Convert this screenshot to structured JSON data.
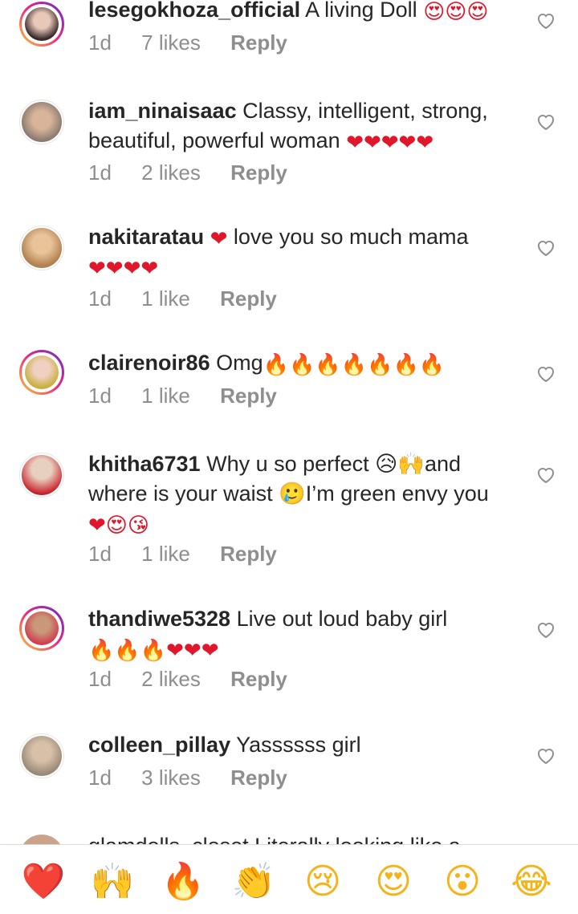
{
  "comments": [
    {
      "username": "lesegokhoza_official",
      "text": "A living Doll",
      "emoji": "😍😍😍",
      "emoji_class": "fire",
      "time": "1d",
      "likes": "7 likes",
      "reply": "Reply"
    },
    {
      "username": "iam_ninaisaac",
      "text": "Classy, intelligent, strong, beautiful, powerful woman",
      "emoji": "❤❤❤❤❤",
      "emoji_class": "red",
      "time": "1d",
      "likes": "2 likes",
      "reply": "Reply"
    },
    {
      "username": "nakitaratau",
      "text": "love you so much mama",
      "emoji_before": "❤",
      "emoji": "❤❤❤❤",
      "emoji_class": "red",
      "time": "1d",
      "likes": "1 like",
      "reply": "Reply"
    },
    {
      "username": "clairenoir86",
      "text": "Omg",
      "emoji": "🔥🔥🔥🔥🔥🔥🔥",
      "emoji_class": "fire",
      "time": "1d",
      "likes": "1 like",
      "reply": "Reply"
    },
    {
      "username": "khitha6731",
      "text": "Why u so perfect 😥🙌and where is your waist 🥲‍I’m green envy you",
      "emoji": "❤😍😘",
      "emoji_class": "red",
      "time": "1d",
      "likes": "1 like",
      "reply": "Reply"
    },
    {
      "username": "thandiwe5328",
      "text": "Live out loud baby girl",
      "emoji": "🔥🔥🔥❤❤❤",
      "emoji_class": "red",
      "time": "1d",
      "likes": "2 likes",
      "reply": "Reply"
    },
    {
      "username": "colleen_pillay",
      "text": "Yassssss girl",
      "emoji": "",
      "emoji_class": "red",
      "time": "1d",
      "likes": "3 likes",
      "reply": "Reply"
    }
  ],
  "peek_comment": "glamdolls_closet Literally looking like a",
  "quick_reactions": [
    "❤️",
    "🙌",
    "🔥",
    "👏",
    "😢",
    "😍",
    "😮",
    "😂"
  ],
  "colors": {
    "accent_red": "#e0162b",
    "muted": "#8e8e8e",
    "text": "#262626"
  },
  "icons": {
    "like": "heart-outline-icon"
  }
}
